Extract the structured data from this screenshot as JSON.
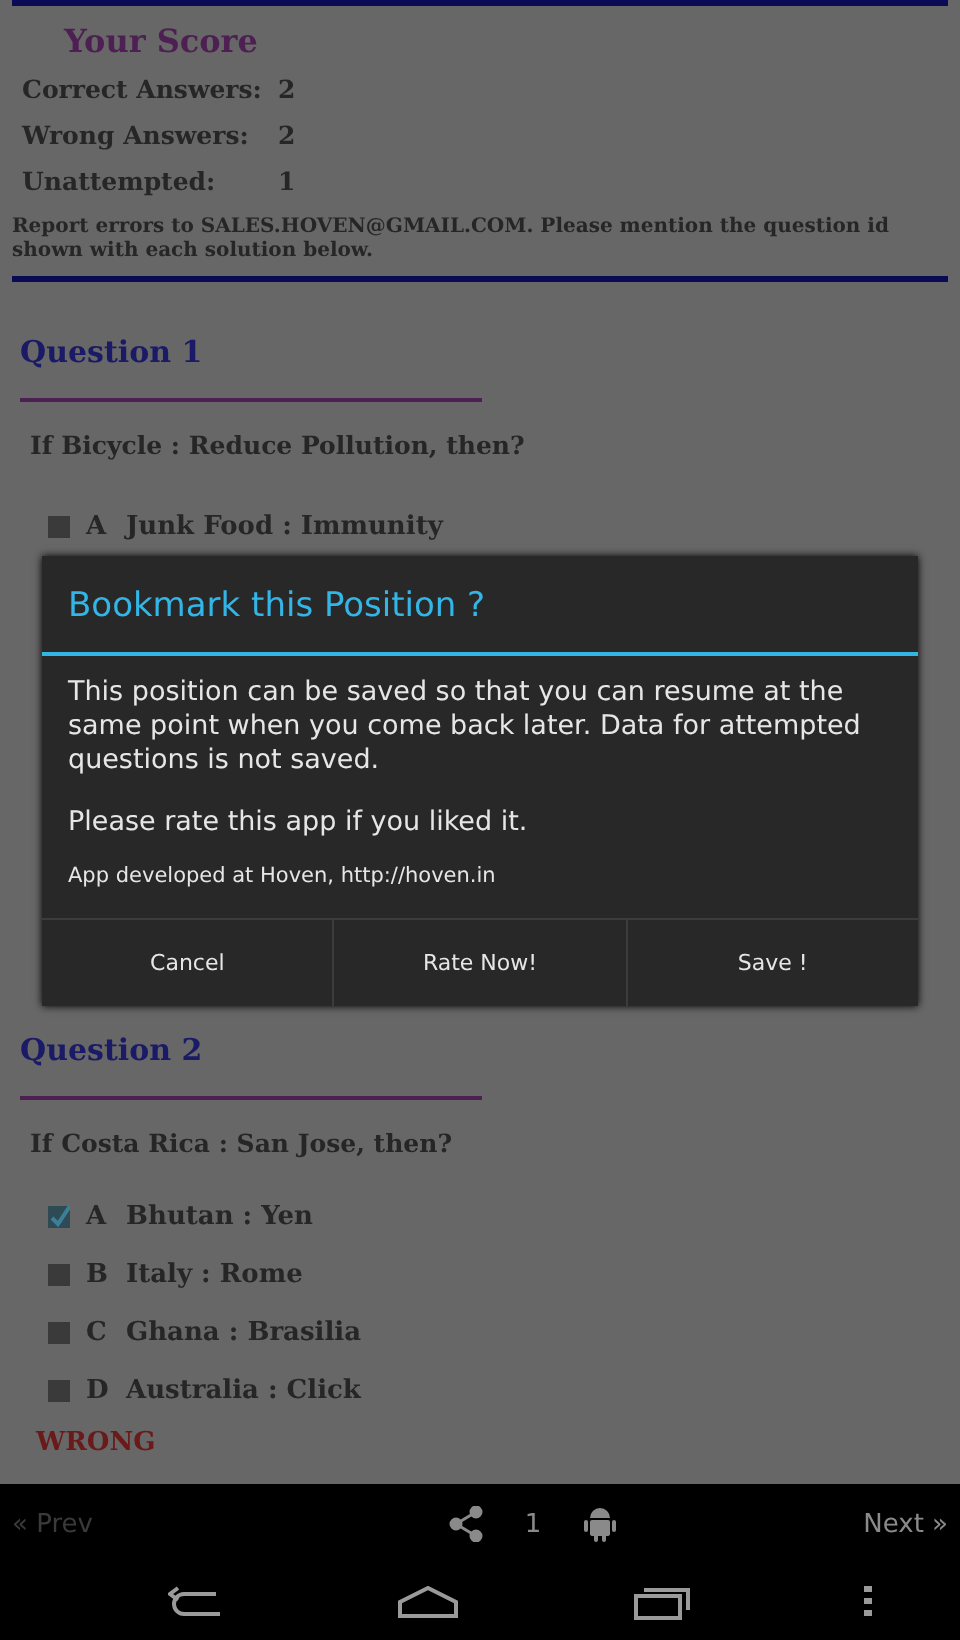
{
  "score": {
    "title": "Your Score",
    "rows": [
      {
        "label": "Correct Answers:",
        "value": "2"
      },
      {
        "label": "Wrong Answers:",
        "value": "2"
      },
      {
        "label": "Unattempted:",
        "value": "1"
      }
    ]
  },
  "report_note": "Report errors to SALES.HOVEN@GMAIL.COM. Please mention the question id shown with each solution below.",
  "questions": [
    {
      "title": "Question 1",
      "text": "If Bicycle : Reduce Pollution, then?",
      "options": [
        {
          "letter": "A",
          "text": "Junk Food : Immunity",
          "checked": false
        }
      ]
    },
    {
      "title": "Question 2",
      "text": "If Costa Rica : San Jose, then?",
      "options": [
        {
          "letter": "A",
          "text": "Bhutan : Yen",
          "checked": true
        },
        {
          "letter": "B",
          "text": "Italy : Rome",
          "checked": false
        },
        {
          "letter": "C",
          "text": "Ghana : Brasilia",
          "checked": false
        },
        {
          "letter": "D",
          "text": "Australia : Click",
          "checked": false
        }
      ],
      "result": "WRONG"
    }
  ],
  "dialog": {
    "title": "Bookmark this Position ?",
    "message": "This position can be saved so that you can resume at the same point when you come back later. Data for attempted questions is not saved.",
    "rate_note": "Please rate this app if you liked it.",
    "credit": "App developed at Hoven, http://hoven.in",
    "buttons": [
      "Cancel",
      "Rate Now!",
      "Save !"
    ]
  },
  "action_bar": {
    "prev": {
      "label": "« Prev",
      "disabled": true
    },
    "page": "1",
    "next": {
      "label": "Next »",
      "disabled": false
    }
  }
}
